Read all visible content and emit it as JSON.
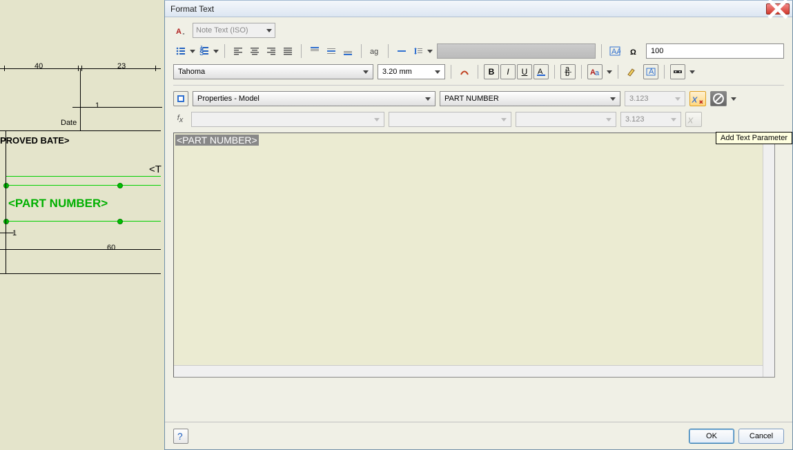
{
  "dialog": {
    "title": "Format Text",
    "style_dropdown": "Note Text (ISO)",
    "font": "Tahoma",
    "size": "3.20 mm",
    "stretch": "100",
    "property_source": "Properties - Model",
    "property_name": "PART NUMBER",
    "precision1": "3.123",
    "precision2": "3.123",
    "text_content": "<PART NUMBER>",
    "tooltip": "Add Text Parameter",
    "ok": "OK",
    "cancel": "Cancel"
  },
  "drawing": {
    "dim40": "40",
    "dim23": "23",
    "dim1a": "1",
    "dim1b": "1",
    "dim60": "60",
    "date": "Date",
    "approved": "PROVED BATE>",
    "tag_t": "<T",
    "part": "<PART NUMBER>"
  }
}
